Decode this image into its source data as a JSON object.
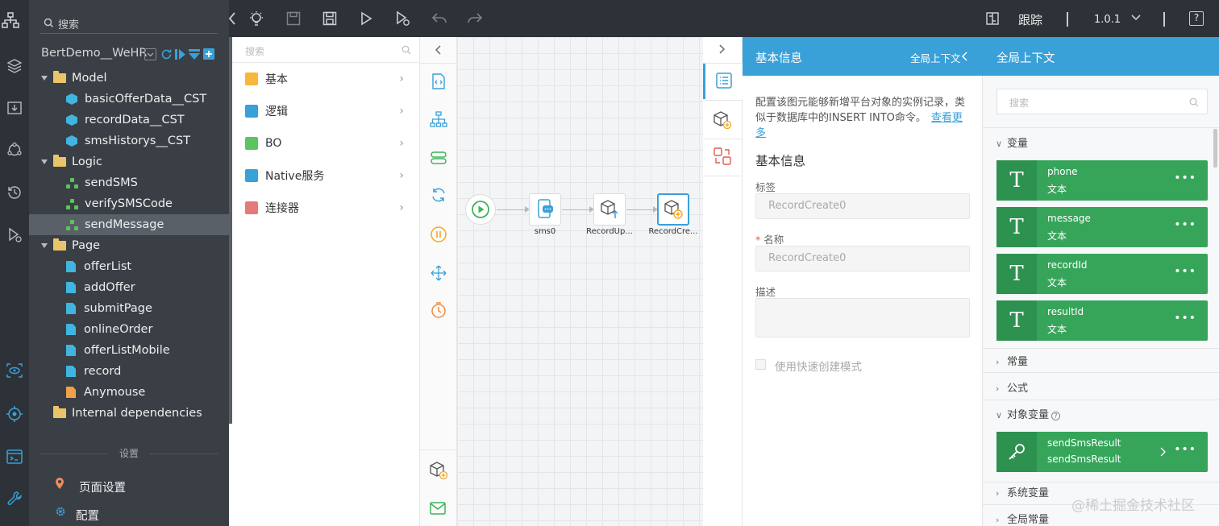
{
  "toolbar": {
    "trace_label": "跟踪",
    "version": "1.0.1",
    "help": "?"
  },
  "tree": {
    "search_placeholder": "搜索",
    "project": "BertDemo__WeHR",
    "items": [
      {
        "label": "Model",
        "kind": "folder"
      },
      {
        "label": "basicOfferData__CST",
        "kind": "object"
      },
      {
        "label": "recordData__CST",
        "kind": "object"
      },
      {
        "label": "smsHistorys__CST",
        "kind": "object"
      },
      {
        "label": "Logic",
        "kind": "folder"
      },
      {
        "label": "sendSMS",
        "kind": "logic"
      },
      {
        "label": "verifySMSCode",
        "kind": "logic"
      },
      {
        "label": "sendMessage",
        "kind": "logic"
      },
      {
        "label": "Page",
        "kind": "folder"
      },
      {
        "label": "offerList",
        "kind": "page"
      },
      {
        "label": "addOffer",
        "kind": "page"
      },
      {
        "label": "submitPage",
        "kind": "page"
      },
      {
        "label": "onlineOrder",
        "kind": "page"
      },
      {
        "label": "offerListMobile",
        "kind": "page"
      },
      {
        "label": "record",
        "kind": "page"
      },
      {
        "label": "Anymouse",
        "kind": "page-orange"
      },
      {
        "label": "Internal dependencies",
        "kind": "folder"
      }
    ],
    "settings_header": "设置",
    "page_settings": "页面设置",
    "config": "配置"
  },
  "palette": {
    "search_placeholder": "搜索",
    "items": [
      {
        "label": "基本",
        "color": "#f5b83d"
      },
      {
        "label": "逻辑",
        "color": "#3aa0d8"
      },
      {
        "label": "BO",
        "color": "#5cc45c"
      },
      {
        "label": "Native服务",
        "color": "#3aa0d8"
      },
      {
        "label": "连接器",
        "color": "#e67a7a"
      }
    ]
  },
  "canvas": {
    "nodes": [
      {
        "label": "sms0"
      },
      {
        "label": "RecordUp..."
      },
      {
        "label": "RecordCre..."
      }
    ]
  },
  "props": {
    "header_title": "基本信息",
    "header_link": "全局上下文",
    "description": "配置该图元能够新增平台对象的实例记录，类似于数据库中的INSERT INTO命令。",
    "more_link": "查看更多",
    "section_title": "基本信息",
    "label_field_label": "标签",
    "label_field_value": "RecordCreate0",
    "name_field_label": "名称",
    "name_field_value": "RecordCreate0",
    "desc_field_label": "描述",
    "quick_mode": "使用快速创建模式"
  },
  "context": {
    "title": "全局上下文",
    "search_placeholder": "搜索",
    "variables_header": "变量",
    "variables": [
      {
        "name": "phone",
        "type": "文本"
      },
      {
        "name": "message",
        "type": "文本"
      },
      {
        "name": "recordId",
        "type": "文本"
      },
      {
        "name": "resultId",
        "type": "文本"
      }
    ],
    "constants_header": "常量",
    "formula_header": "公式",
    "object_vars_header": "对象变量",
    "object_var": {
      "name": "sendSmsResult",
      "type": "sendSmsResult"
    },
    "system_vars_header": "系统变量",
    "global_constants_header": "全局常量"
  },
  "watermark": "@稀土掘金技术社区"
}
